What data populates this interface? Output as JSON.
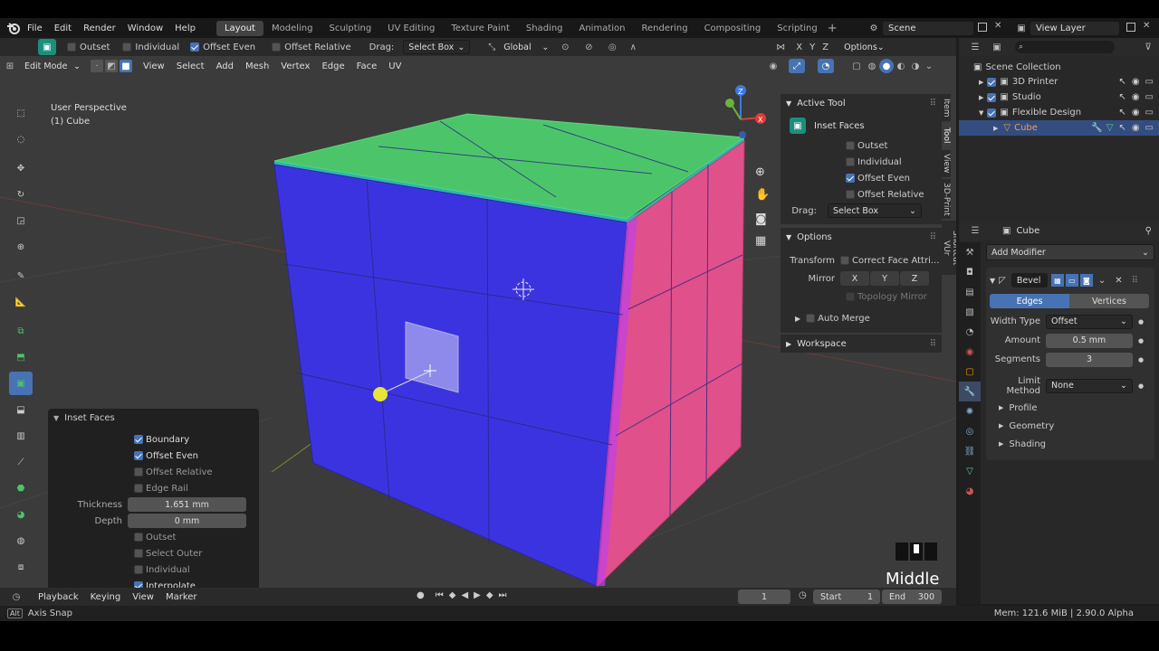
{
  "topbar": {
    "menus": [
      "File",
      "Edit",
      "Render",
      "Window",
      "Help"
    ],
    "workspaces": [
      "Layout",
      "Modeling",
      "Sculpting",
      "UV Editing",
      "Texture Paint",
      "Shading",
      "Animation",
      "Rendering",
      "Compositing",
      "Scripting"
    ],
    "active_workspace": "Layout",
    "add_tab": "+",
    "scene": "Scene",
    "view_layer": "View Layer"
  },
  "tool_header": {
    "outset": "Outset",
    "individual": "Individual",
    "offset_even": "Offset Even",
    "offset_relative": "Offset Relative",
    "drag_label": "Drag:",
    "drag_value": "Select Box",
    "orientation": "Global",
    "axes": [
      "X",
      "Y",
      "Z"
    ],
    "options": "Options"
  },
  "header": {
    "mode": "Edit Mode",
    "menus": [
      "View",
      "Select",
      "Add",
      "Mesh",
      "Vertex",
      "Edge",
      "Face",
      "UV"
    ]
  },
  "viewport": {
    "perspective": "User Perspective",
    "object": "(1) Cube",
    "overlay_text": "Middle",
    "gizmo": {
      "x": "X",
      "y": "Y",
      "z": "Z"
    }
  },
  "operator_panel": {
    "title": "Inset Faces",
    "boundary": "Boundary",
    "offset_even": "Offset Even",
    "offset_relative": "Offset Relative",
    "edge_rail": "Edge Rail",
    "thickness_label": "Thickness",
    "thickness_value": "1.651 mm",
    "depth_label": "Depth",
    "depth_value": "0 mm",
    "outset": "Outset",
    "select_outer": "Select Outer",
    "individual": "Individual",
    "interpolate": "Interpolate"
  },
  "npanel": {
    "active_tool_title": "Active Tool",
    "tool_name": "Inset Faces",
    "outset": "Outset",
    "individual": "Individual",
    "offset_even": "Offset Even",
    "offset_relative": "Offset Relative",
    "drag_label": "Drag:",
    "drag_value": "Select Box",
    "options_title": "Options",
    "transform_label": "Transform",
    "correct_face": "Correct Face Attri...",
    "mirror_label": "Mirror",
    "mirror_axes": [
      "X",
      "Y",
      "Z"
    ],
    "topology_mirror": "Topology Mirror",
    "auto_merge": "Auto Merge",
    "workspace_title": "Workspace",
    "tabs": [
      "Item",
      "Tool",
      "View",
      "3D-Print",
      "Shortcut VUr"
    ]
  },
  "outliner": {
    "root": "Scene Collection",
    "items": [
      "3D Printer",
      "Studio",
      "Flexible Design",
      "Cube"
    ]
  },
  "properties": {
    "object_name": "Cube",
    "add_modifier": "Add Modifier",
    "modifier_name": "Bevel",
    "seg_edges": "Edges",
    "seg_vertices": "Vertices",
    "width_type_label": "Width Type",
    "width_type_value": "Offset",
    "amount_label": "Amount",
    "amount_value": "0.5 mm",
    "segments_label": "Segments",
    "segments_value": "3",
    "limit_method_label": "Limit Method",
    "limit_method_value": "None",
    "profile": "Profile",
    "geometry": "Geometry",
    "shading": "Shading"
  },
  "timeline": {
    "menus": [
      "Playback",
      "Keying",
      "View",
      "Marker"
    ],
    "current_frame": "1",
    "start_label": "Start",
    "start_value": "1",
    "end_label": "End",
    "end_value": "300"
  },
  "statusbar": {
    "key": "Alt",
    "hint": "Axis Snap",
    "stats": "Mem: 121.6 MiB | 2.90.0 Alpha"
  },
  "colors": {
    "accent": "#4772b3",
    "face_top": "#4cc56a",
    "face_front": "#3c33e0",
    "face_right": "#e0508a",
    "active_vertex": "#e8e53a"
  }
}
